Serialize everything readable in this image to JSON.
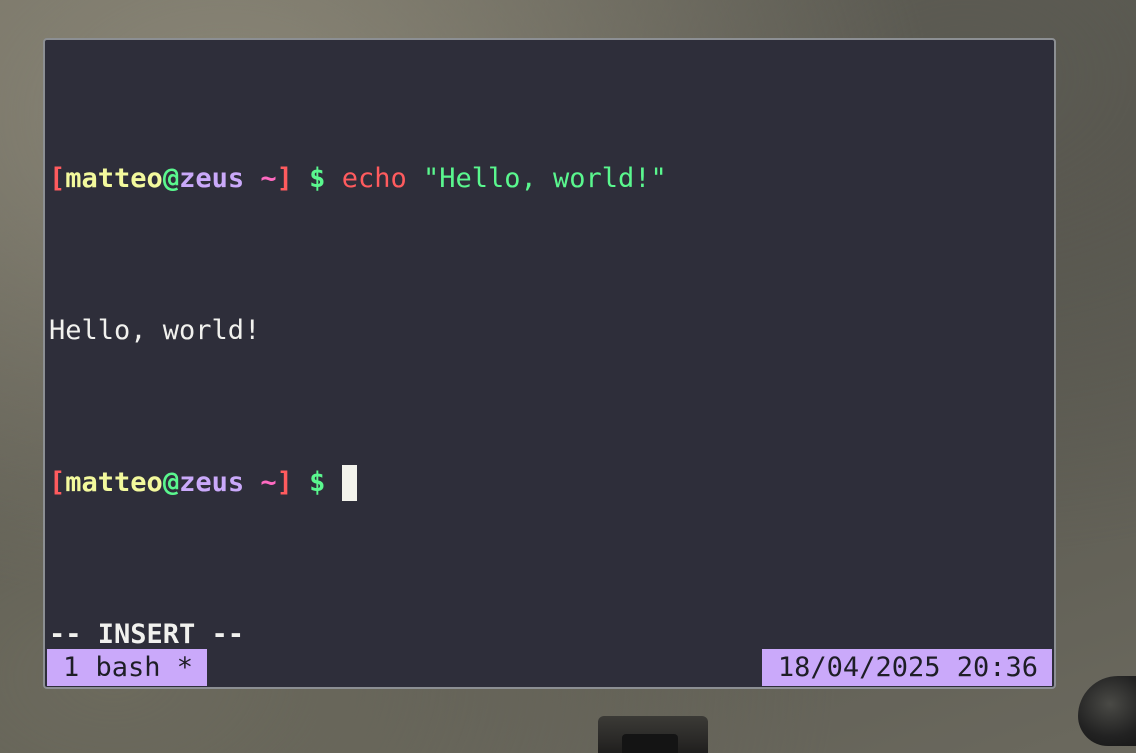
{
  "terminal": {
    "prompt": {
      "open_bracket": "[",
      "user": "matteo",
      "at": "@",
      "host": "zeus",
      "dir": " ~",
      "close_bracket": "]",
      "symbol": "$"
    },
    "lines": {
      "command": "echo",
      "argument": "\"Hello, world!\"",
      "output": "Hello, world!"
    },
    "mode_indicator": "-- INSERT --"
  },
  "statusbar": {
    "window_label": "1 bash *",
    "datetime": "18/04/2025 20:36"
  },
  "colors": {
    "background": "#2e2e3a",
    "foreground": "#f1f1ee",
    "red": "#ff5b5e",
    "yellow": "#f3f99d",
    "green": "#5af78e",
    "purple": "#caa9fa",
    "pink": "#ff6ac1"
  }
}
